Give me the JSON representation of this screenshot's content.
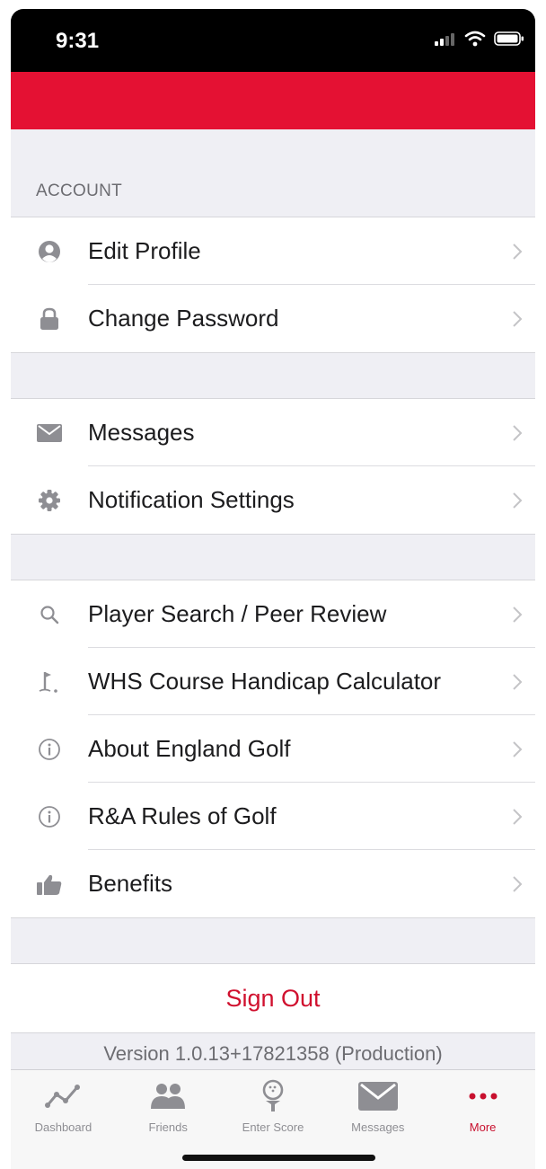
{
  "status_bar": {
    "time": "9:31",
    "icons": [
      "cellular-signal-icon",
      "wifi-icon",
      "battery-icon"
    ]
  },
  "colors": {
    "brand_red": "#e41133",
    "signout_red": "#d0102e",
    "active_tab": "#c8102e",
    "icon_gray": "#8e8e93",
    "group_background": "#efeff4"
  },
  "account": {
    "header": "ACCOUNT",
    "items": [
      {
        "label": "Edit Profile",
        "icon": "user-icon"
      },
      {
        "label": "Change Password",
        "icon": "lock-icon"
      }
    ]
  },
  "communication": {
    "items": [
      {
        "label": "Messages",
        "icon": "envelope-icon"
      },
      {
        "label": "Notification Settings",
        "icon": "gear-icon"
      }
    ]
  },
  "tools": {
    "items": [
      {
        "label": "Player Search / Peer Review",
        "icon": "search-icon"
      },
      {
        "label": "WHS Course Handicap Calculator",
        "icon": "golf-flag-icon"
      },
      {
        "label": "About England Golf",
        "icon": "info-icon"
      },
      {
        "label": "R&A Rules of Golf",
        "icon": "info-icon"
      },
      {
        "label": "Benefits",
        "icon": "thumbs-up-icon"
      }
    ]
  },
  "sign_out": {
    "label": "Sign Out"
  },
  "version": "Version 1.0.13+17821358 (Production)",
  "tabbar": {
    "active": "More",
    "tabs": [
      {
        "label": "Dashboard",
        "icon": "line-chart-icon"
      },
      {
        "label": "Friends",
        "icon": "friends-icon"
      },
      {
        "label": "Enter Score",
        "icon": "golf-tee-icon"
      },
      {
        "label": "Messages",
        "icon": "envelope-icon"
      },
      {
        "label": "More",
        "icon": "more-dots-icon"
      }
    ]
  }
}
